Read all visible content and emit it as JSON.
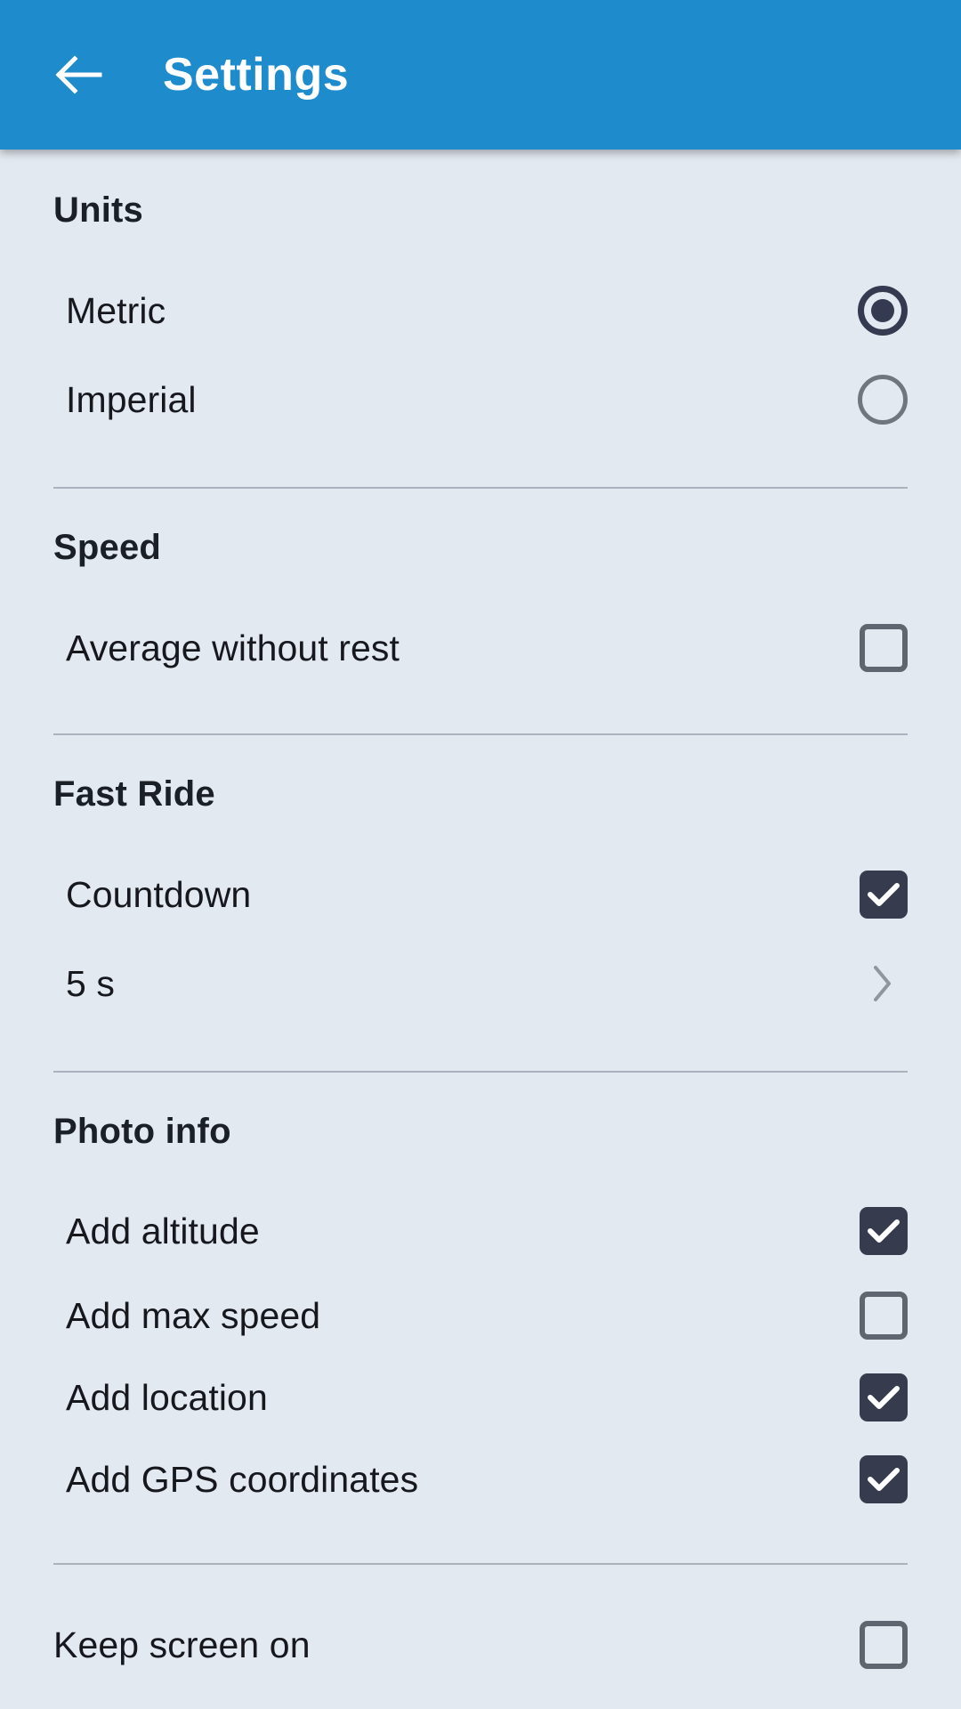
{
  "appbar": {
    "title": "Settings",
    "back_icon": "arrow-left-icon",
    "background_color": "#1e8bcd",
    "text_color": "#ffffff"
  },
  "theme": {
    "page_background": "#e3e9f0",
    "accent_dark": "#363b4e",
    "control_off": "#5f666f",
    "divider": "#a9b2bd",
    "label_color": "#16181d"
  },
  "sections": [
    {
      "id": "units",
      "header": "Units",
      "control_type": "radio",
      "rows": [
        {
          "label": "Metric",
          "control": "radio",
          "state": "on"
        },
        {
          "label": "Imperial",
          "control": "radio",
          "state": "off"
        }
      ]
    },
    {
      "id": "speed",
      "header": "Speed",
      "control_type": "checkbox",
      "rows": [
        {
          "label": "Average without rest",
          "control": "checkbox",
          "state": "off"
        }
      ]
    },
    {
      "id": "fast-ride",
      "header": "Fast Ride",
      "control_type": "mixed",
      "rows": [
        {
          "label": "Countdown",
          "control": "checkbox",
          "state": "on"
        },
        {
          "label": "5 s",
          "control": "chevron",
          "state": "na"
        }
      ]
    },
    {
      "id": "photo-info",
      "header": "Photo info",
      "control_type": "checkbox",
      "rows": [
        {
          "label": "Add altitude",
          "control": "checkbox",
          "state": "on"
        },
        {
          "label": "Add max speed",
          "control": "checkbox",
          "state": "off"
        },
        {
          "label": "Add location",
          "control": "checkbox",
          "state": "on"
        },
        {
          "label": "Add GPS coordinates",
          "control": "checkbox",
          "state": "on"
        }
      ]
    },
    {
      "id": "display",
      "header": null,
      "control_type": "checkbox",
      "rows": [
        {
          "label": "Keep screen on",
          "control": "checkbox",
          "state": "off"
        }
      ]
    }
  ]
}
